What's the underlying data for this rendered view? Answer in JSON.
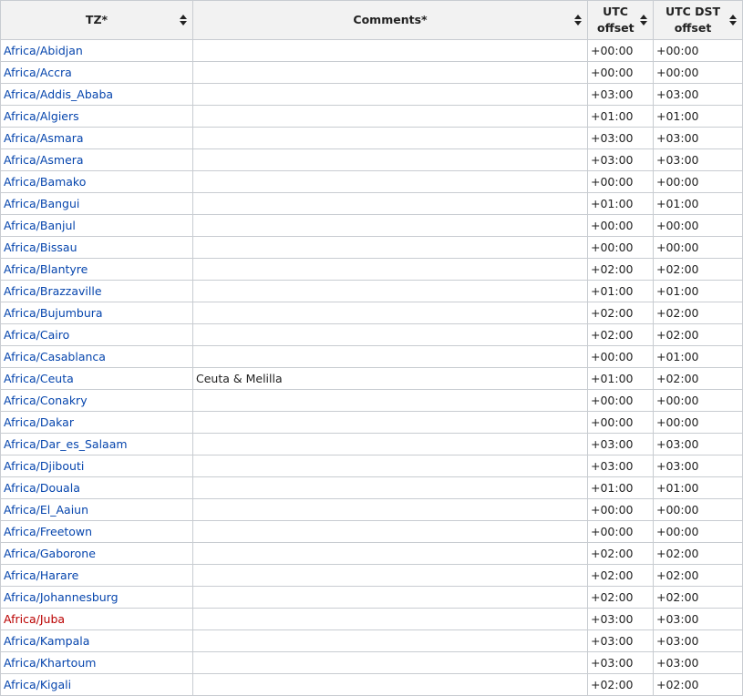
{
  "table": {
    "headers": [
      {
        "label": "TZ*",
        "name": "tz"
      },
      {
        "label": "Comments*",
        "name": "comments"
      },
      {
        "label": "UTC offset",
        "name": "utc-offset"
      },
      {
        "label": "UTC DST offset",
        "name": "utc-dst-offset"
      }
    ],
    "rows": [
      {
        "tz": "Africa/Abidjan",
        "comment": "",
        "utc": "+00:00",
        "dst": "+00:00",
        "missing": false
      },
      {
        "tz": "Africa/Accra",
        "comment": "",
        "utc": "+00:00",
        "dst": "+00:00",
        "missing": false
      },
      {
        "tz": "Africa/Addis_Ababa",
        "comment": "",
        "utc": "+03:00",
        "dst": "+03:00",
        "missing": false
      },
      {
        "tz": "Africa/Algiers",
        "comment": "",
        "utc": "+01:00",
        "dst": "+01:00",
        "missing": false
      },
      {
        "tz": "Africa/Asmara",
        "comment": "",
        "utc": "+03:00",
        "dst": "+03:00",
        "missing": false
      },
      {
        "tz": "Africa/Asmera",
        "comment": "",
        "utc": "+03:00",
        "dst": "+03:00",
        "missing": false
      },
      {
        "tz": "Africa/Bamako",
        "comment": "",
        "utc": "+00:00",
        "dst": "+00:00",
        "missing": false
      },
      {
        "tz": "Africa/Bangui",
        "comment": "",
        "utc": "+01:00",
        "dst": "+01:00",
        "missing": false
      },
      {
        "tz": "Africa/Banjul",
        "comment": "",
        "utc": "+00:00",
        "dst": "+00:00",
        "missing": false
      },
      {
        "tz": "Africa/Bissau",
        "comment": "",
        "utc": "+00:00",
        "dst": "+00:00",
        "missing": false
      },
      {
        "tz": "Africa/Blantyre",
        "comment": "",
        "utc": "+02:00",
        "dst": "+02:00",
        "missing": false
      },
      {
        "tz": "Africa/Brazzaville",
        "comment": "",
        "utc": "+01:00",
        "dst": "+01:00",
        "missing": false
      },
      {
        "tz": "Africa/Bujumbura",
        "comment": "",
        "utc": "+02:00",
        "dst": "+02:00",
        "missing": false
      },
      {
        "tz": "Africa/Cairo",
        "comment": "",
        "utc": "+02:00",
        "dst": "+02:00",
        "missing": false
      },
      {
        "tz": "Africa/Casablanca",
        "comment": "",
        "utc": "+00:00",
        "dst": "+01:00",
        "missing": false
      },
      {
        "tz": "Africa/Ceuta",
        "comment": "Ceuta & Melilla",
        "utc": "+01:00",
        "dst": "+02:00",
        "missing": false
      },
      {
        "tz": "Africa/Conakry",
        "comment": "",
        "utc": "+00:00",
        "dst": "+00:00",
        "missing": false
      },
      {
        "tz": "Africa/Dakar",
        "comment": "",
        "utc": "+00:00",
        "dst": "+00:00",
        "missing": false
      },
      {
        "tz": "Africa/Dar_es_Salaam",
        "comment": "",
        "utc": "+03:00",
        "dst": "+03:00",
        "missing": false
      },
      {
        "tz": "Africa/Djibouti",
        "comment": "",
        "utc": "+03:00",
        "dst": "+03:00",
        "missing": false
      },
      {
        "tz": "Africa/Douala",
        "comment": "",
        "utc": "+01:00",
        "dst": "+01:00",
        "missing": false
      },
      {
        "tz": "Africa/El_Aaiun",
        "comment": "",
        "utc": "+00:00",
        "dst": "+00:00",
        "missing": false
      },
      {
        "tz": "Africa/Freetown",
        "comment": "",
        "utc": "+00:00",
        "dst": "+00:00",
        "missing": false
      },
      {
        "tz": "Africa/Gaborone",
        "comment": "",
        "utc": "+02:00",
        "dst": "+02:00",
        "missing": false
      },
      {
        "tz": "Africa/Harare",
        "comment": "",
        "utc": "+02:00",
        "dst": "+02:00",
        "missing": false
      },
      {
        "tz": "Africa/Johannesburg",
        "comment": "",
        "utc": "+02:00",
        "dst": "+02:00",
        "missing": false
      },
      {
        "tz": "Africa/Juba",
        "comment": "",
        "utc": "+03:00",
        "dst": "+03:00",
        "missing": true
      },
      {
        "tz": "Africa/Kampala",
        "comment": "",
        "utc": "+03:00",
        "dst": "+03:00",
        "missing": false
      },
      {
        "tz": "Africa/Khartoum",
        "comment": "",
        "utc": "+03:00",
        "dst": "+03:00",
        "missing": false
      },
      {
        "tz": "Africa/Kigali",
        "comment": "",
        "utc": "+02:00",
        "dst": "+02:00",
        "missing": false
      }
    ]
  },
  "icons": {
    "sort": "sort-arrows-icon"
  },
  "colors": {
    "link": "#0645ad",
    "missing_link": "#ba0000",
    "header_bg": "#f2f2f2",
    "border": "#c8ccd1"
  }
}
